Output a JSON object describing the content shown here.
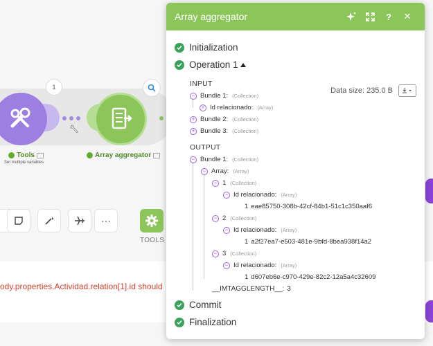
{
  "canvas": {
    "tools_bubble_count": "1",
    "tools_label": "Tools",
    "tools_sublabel": "Set multiple variables",
    "agg_label": "Array aggregator",
    "toolbar_more": "···",
    "tools_button_label": "TOOLS",
    "error_text": "ody.properties.Actividad.relation[1].id should"
  },
  "colors": {
    "accent_green": "#8cc65a",
    "tools_purple": "#9c7fe0",
    "check_green": "#3aa25a",
    "error_red": "#d3412d",
    "tree_purple": "#9b5fe0"
  },
  "panel": {
    "title": "Array aggregator",
    "header_icons": [
      "magic-icon",
      "expand-icon",
      "help-icon",
      "close-icon"
    ],
    "help_glyph": "?",
    "close_glyph": "✕",
    "stages": {
      "initialization": "Initialization",
      "operation": "Operation 1",
      "commit": "Commit",
      "finalization": "Finalization"
    },
    "data_size": "Data size: 235.0 B",
    "input_label": "INPUT",
    "output_label": "OUTPUT",
    "input": {
      "b1": {
        "label": "Bundle 1:",
        "type": "(Collection)"
      },
      "b1_field": {
        "label": "Id relacionado:",
        "type": "(Array)"
      },
      "b2": {
        "label": "Bundle 2:",
        "type": "(Collection)"
      },
      "b3": {
        "label": "Bundle 3:",
        "type": "(Collection)"
      }
    },
    "output": {
      "b1": {
        "label": "Bundle 1:",
        "type": "(Collection)"
      },
      "array": {
        "label": "Array:",
        "type": "(Array)"
      },
      "items": [
        {
          "index": "1",
          "type": "(Collection)",
          "field": "Id relacionado:",
          "field_type": "(Array)",
          "sub_index": "1",
          "value": "eae85750-308b-42cf-84b1-51c1c350aaf6"
        },
        {
          "index": "2",
          "type": "(Collection)",
          "field": "Id relacionado:",
          "field_type": "(Array)",
          "sub_index": "1",
          "value": "a2f27ea7-e503-481e-9bfd-8bea938f14a2"
        },
        {
          "index": "3",
          "type": "(Collection)",
          "field": "Id relacionado:",
          "field_type": "(Array)",
          "sub_index": "1",
          "value": "d607eb6e-c970-429e-82c2-12a5a4c32609"
        }
      ],
      "length_label": "__IMTAGGLENGTH__:",
      "length_value": "3"
    }
  }
}
